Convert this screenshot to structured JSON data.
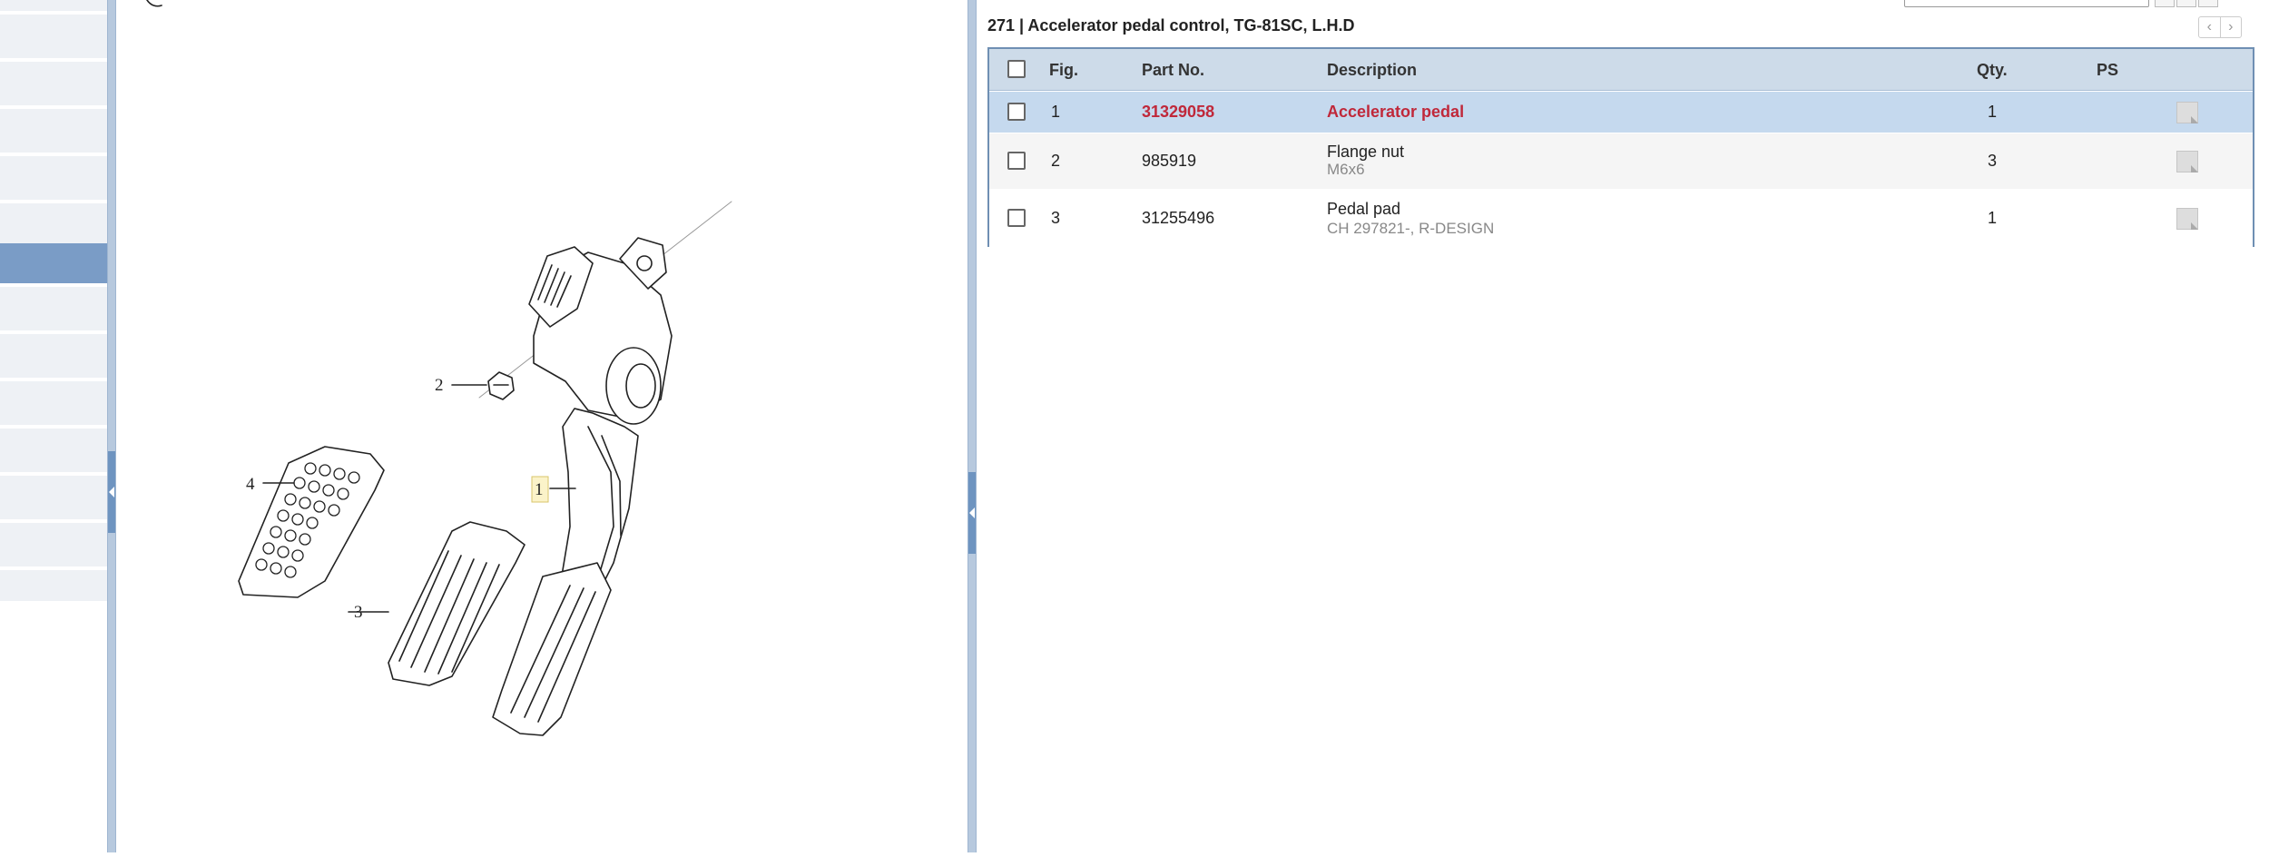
{
  "illustration": {
    "callouts": {
      "c1": "1",
      "c2": "2",
      "c3": "3",
      "c4": "4"
    }
  },
  "group": {
    "title": "271  |  Accelerator pedal control, TG-81SC, L.H.D",
    "prev_label": "‹",
    "next_label": "›"
  },
  "table": {
    "headers": {
      "fig": "Fig.",
      "part_no": "Part No.",
      "description": "Description",
      "qty": "Qty.",
      "ps": "PS"
    },
    "rows": [
      {
        "fig": "1",
        "part_no": "31329058",
        "description": "Accelerator pedal",
        "note": "",
        "qty": "1"
      },
      {
        "fig": "2",
        "part_no": "985919",
        "description": "Flange nut",
        "note": "M6x6",
        "qty": "3"
      },
      {
        "fig": "3",
        "part_no": "31255496",
        "description": "Pedal pad",
        "note": "CH 297821-, R-DESIGN",
        "qty": "1"
      }
    ]
  },
  "colors": {
    "accent": "#7a9cc6",
    "selected_row": "#c5d9ee",
    "highlight_text": "#c0283a",
    "header_bg": "#cddbe9"
  }
}
